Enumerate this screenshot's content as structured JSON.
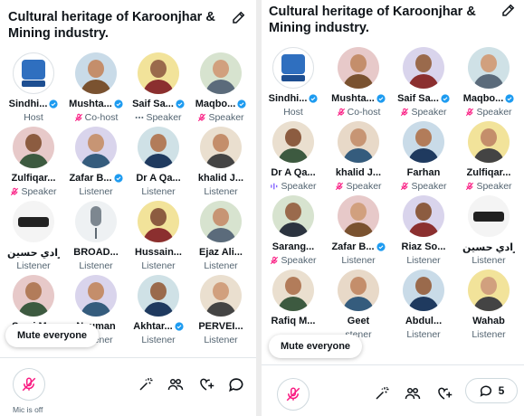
{
  "left_panel": {
    "title": "Cultural heritage of Karoonjhar & Mining industry.",
    "participants": [
      {
        "name": "Sindhi...",
        "role": "Host",
        "role_icon": "",
        "verified": true,
        "avatar": "logo",
        "logo_text": "SAUA"
      },
      {
        "name": "Mushta...",
        "role": "Co-host",
        "role_icon": "mic-off-icon",
        "verified": true,
        "avatar": "person"
      },
      {
        "name": "Saif Sa...",
        "role": "Speaker",
        "role_icon": "dots-icon",
        "verified": true,
        "avatar": "person"
      },
      {
        "name": "Maqbo...",
        "role": "Speaker",
        "role_icon": "mic-off-icon",
        "verified": true,
        "avatar": "person"
      },
      {
        "name": "Zulfiqar...",
        "role": "Speaker",
        "role_icon": "mic-off-icon",
        "verified": false,
        "avatar": "person"
      },
      {
        "name": "Zafar B...",
        "role": "Listener",
        "role_icon": "",
        "verified": true,
        "avatar": "person"
      },
      {
        "name": "Dr A Qa...",
        "role": "Listener",
        "role_icon": "",
        "verified": false,
        "avatar": "person"
      },
      {
        "name": "khalid J...",
        "role": "Listener",
        "role_icon": "",
        "verified": false,
        "avatar": "person"
      },
      {
        "name": "شهرادي حسين",
        "role": "Listener",
        "role_icon": "",
        "verified": false,
        "avatar": "script"
      },
      {
        "name": "BROAD...",
        "role": "Listener",
        "role_icon": "",
        "verified": false,
        "avatar": "mic"
      },
      {
        "name": "Hussain...",
        "role": "Listener",
        "role_icon": "",
        "verified": false,
        "avatar": "person"
      },
      {
        "name": "Ejaz Ali...",
        "role": "Listener",
        "role_icon": "",
        "verified": false,
        "avatar": "person"
      },
      {
        "name": "Sami M...",
        "role": "",
        "role_icon": "",
        "verified": false,
        "avatar": "person"
      },
      {
        "name": "Nauman",
        "role": "Listener",
        "role_icon": "",
        "verified": false,
        "avatar": "person"
      },
      {
        "name": "Akhtar...",
        "role": "Listener",
        "role_icon": "",
        "verified": true,
        "avatar": "person"
      },
      {
        "name": "PERVEI...",
        "role": "Listener",
        "role_icon": "",
        "verified": false,
        "avatar": "person"
      }
    ],
    "mute_label": "Mute everyone",
    "mic_status": "Mic is off"
  },
  "right_panel": {
    "title": "Cultural heritage of Karoonjhar & Mining industry.",
    "participants": [
      {
        "name": "Sindhi...",
        "role": "Host",
        "role_icon": "",
        "verified": true,
        "avatar": "logo",
        "logo_text": "SAUA"
      },
      {
        "name": "Mushta...",
        "role": "Co-host",
        "role_icon": "mic-off-icon",
        "verified": true,
        "avatar": "person"
      },
      {
        "name": "Saif Sa...",
        "role": "Speaker",
        "role_icon": "mic-off-icon",
        "verified": true,
        "avatar": "person"
      },
      {
        "name": "Maqbo...",
        "role": "Speaker",
        "role_icon": "mic-off-icon",
        "verified": true,
        "avatar": "person"
      },
      {
        "name": "Dr A Qa...",
        "role": "Speaker",
        "role_icon": "speaking-icon",
        "verified": false,
        "avatar": "person"
      },
      {
        "name": "khalid J...",
        "role": "Speaker",
        "role_icon": "mic-off-icon",
        "verified": false,
        "avatar": "person"
      },
      {
        "name": "Farhan",
        "role": "Speaker",
        "role_icon": "mic-off-icon",
        "verified": false,
        "avatar": "person"
      },
      {
        "name": "Zulfiqar...",
        "role": "Speaker",
        "role_icon": "mic-off-icon",
        "verified": false,
        "avatar": "person"
      },
      {
        "name": "Sarang...",
        "role": "Speaker",
        "role_icon": "mic-off-icon",
        "verified": false,
        "avatar": "person"
      },
      {
        "name": "Zafar B...",
        "role": "Listener",
        "role_icon": "",
        "verified": true,
        "avatar": "person"
      },
      {
        "name": "Riaz So...",
        "role": "Listener",
        "role_icon": "",
        "verified": false,
        "avatar": "person"
      },
      {
        "name": "شهرادي حسين",
        "role": "Listener",
        "role_icon": "",
        "verified": false,
        "avatar": "script"
      },
      {
        "name": "Rafiq M...",
        "role": "",
        "role_icon": "",
        "verified": false,
        "avatar": "person"
      },
      {
        "name": "Geet",
        "role": "stener",
        "role_icon": "",
        "verified": false,
        "avatar": "person"
      },
      {
        "name": "Abdul...",
        "role": "Listener",
        "role_icon": "",
        "verified": false,
        "avatar": "person"
      },
      {
        "name": "Wahab",
        "role": "Listener",
        "role_icon": "",
        "verified": false,
        "avatar": "person"
      }
    ],
    "mute_label": "Mute everyone",
    "reply_count": "5"
  },
  "colors": {
    "verified": "#1d9bf0",
    "mic_off": "#f91880",
    "role_text": "#536471",
    "speaking": "#7856ff"
  },
  "icons": {
    "edit": "pencil-icon",
    "effects": "magic-wand-icon",
    "people": "people-icon",
    "reaction": "heart-plus-icon",
    "reply": "chat-bubble-icon"
  }
}
